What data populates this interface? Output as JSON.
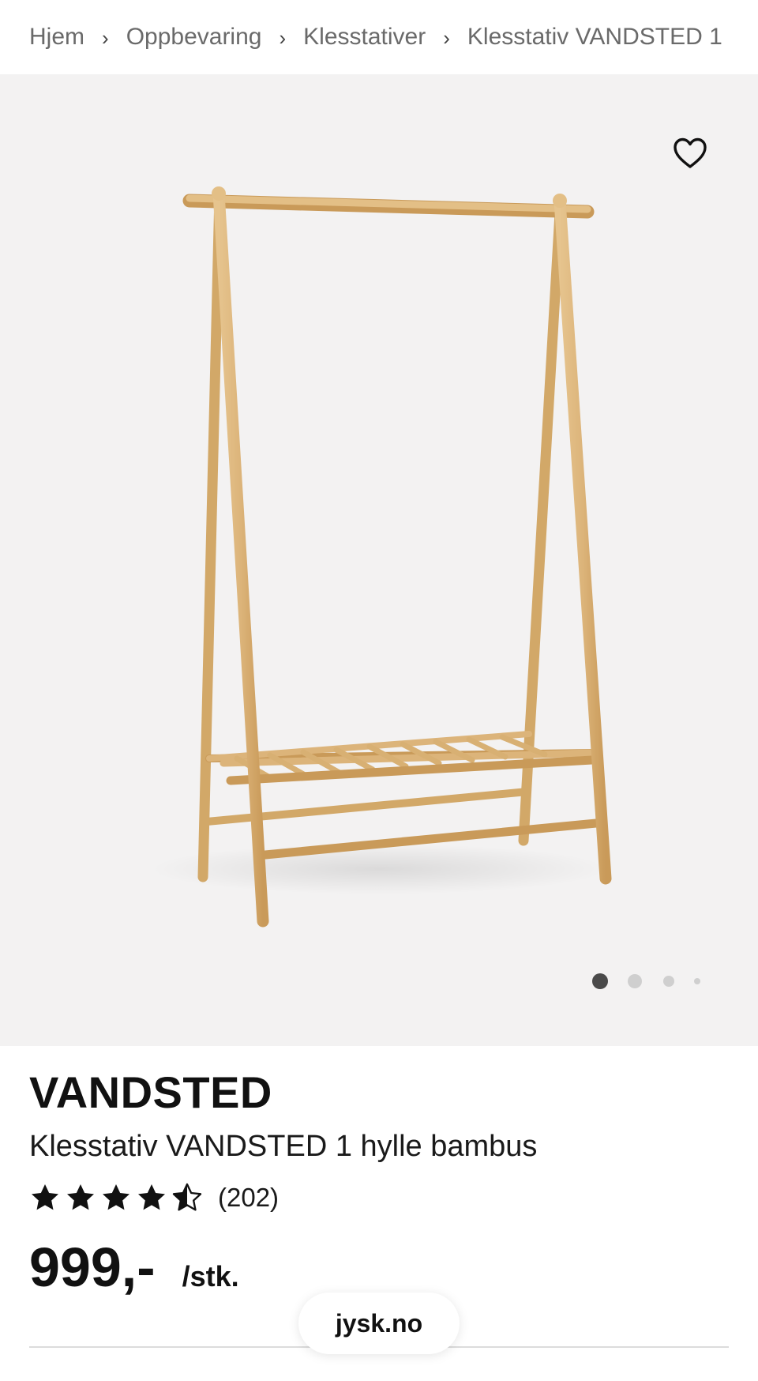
{
  "breadcrumb": {
    "items": [
      "Hjem",
      "Oppbevaring",
      "Klesstativer",
      "Klesstativ VANDSTED 1"
    ],
    "separator": "›"
  },
  "gallery": {
    "favorite_icon": "heart-outline-icon",
    "image_count": 4,
    "active_index": 0,
    "background": "#f3f2f2"
  },
  "product": {
    "brand": "VANDSTED",
    "title": "Klesstativ VANDSTED 1 hylle bambus",
    "rating": 4.5,
    "rating_max": 5,
    "review_count": "(202)",
    "price": "999,-",
    "unit": "/stk."
  },
  "site": {
    "domain": "jysk.no"
  },
  "colors": {
    "wood": "#dcb47a",
    "wood_dark": "#c99a59",
    "star": "#111111",
    "breadcrumb_text": "#6a6a6a"
  }
}
